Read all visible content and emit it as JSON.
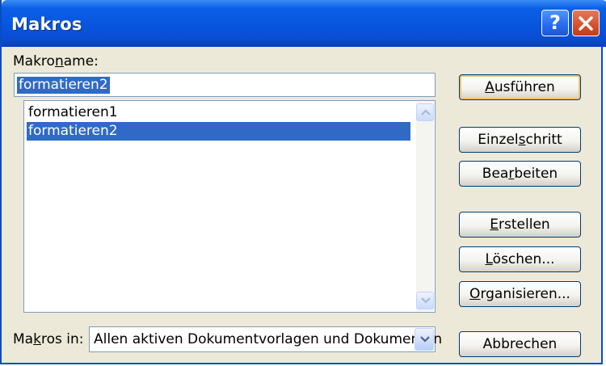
{
  "window": {
    "title": "Makros",
    "help_label": "?"
  },
  "macro_name": {
    "label_pre": "Makro",
    "label_u": "n",
    "label_post": "ame:",
    "value": "formatieren2"
  },
  "macro_list": {
    "items": [
      {
        "label": "formatieren1",
        "selected": false
      },
      {
        "label": "formatieren2",
        "selected": true
      }
    ]
  },
  "buttons": {
    "run": {
      "pre": "",
      "u": "A",
      "post": "usführen"
    },
    "step": {
      "pre": "Einzel",
      "u": "s",
      "post": "chritt"
    },
    "edit": {
      "pre": "Bea",
      "u": "r",
      "post": "beiten"
    },
    "create": {
      "pre": "",
      "u": "E",
      "post": "rstellen"
    },
    "delete": {
      "pre": "",
      "u": "L",
      "post": "öschen..."
    },
    "organize": {
      "pre": "",
      "u": "O",
      "post": "rganisieren..."
    },
    "cancel": {
      "label": "Abbrechen"
    }
  },
  "macros_in": {
    "label_pre": "Ma",
    "label_u": "k",
    "label_post": "ros in:",
    "selected_value": "Allen aktiven Dokumentvorlagen und Dokumenten"
  },
  "colors": {
    "title_blue": "#0754dc",
    "selection": "#316ac5",
    "dialog_bg": "#ece9d8"
  }
}
